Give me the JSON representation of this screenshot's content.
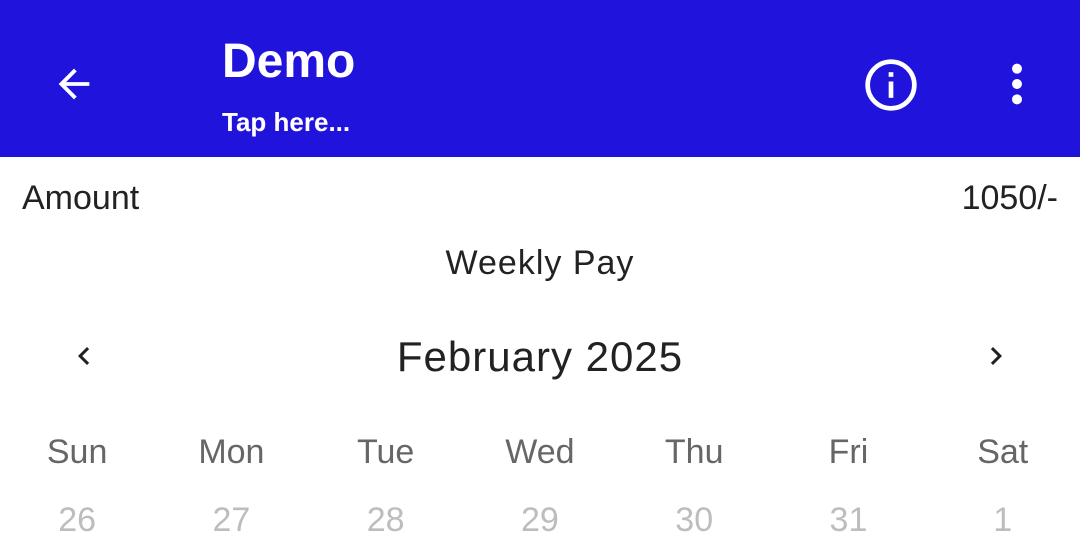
{
  "appbar": {
    "title": "Demo",
    "subtitle": "Tap here...",
    "background_color": "#2014dc",
    "icons": {
      "back": "arrow-left-icon",
      "info": "info-circle-icon",
      "more": "more-vertical-icon"
    }
  },
  "summary": {
    "amount_label": "Amount",
    "amount_value": "1050/-",
    "plan_label": "Weekly Pay"
  },
  "calendar": {
    "month_title": "February 2025",
    "prev_icon": "chevron-left-icon",
    "next_icon": "chevron-right-icon",
    "weekdays": [
      "Sun",
      "Mon",
      "Tue",
      "Wed",
      "Thu",
      "Fri",
      "Sat"
    ],
    "first_row_days": [
      "26",
      "27",
      "28",
      "29",
      "30",
      "31",
      "1"
    ]
  }
}
